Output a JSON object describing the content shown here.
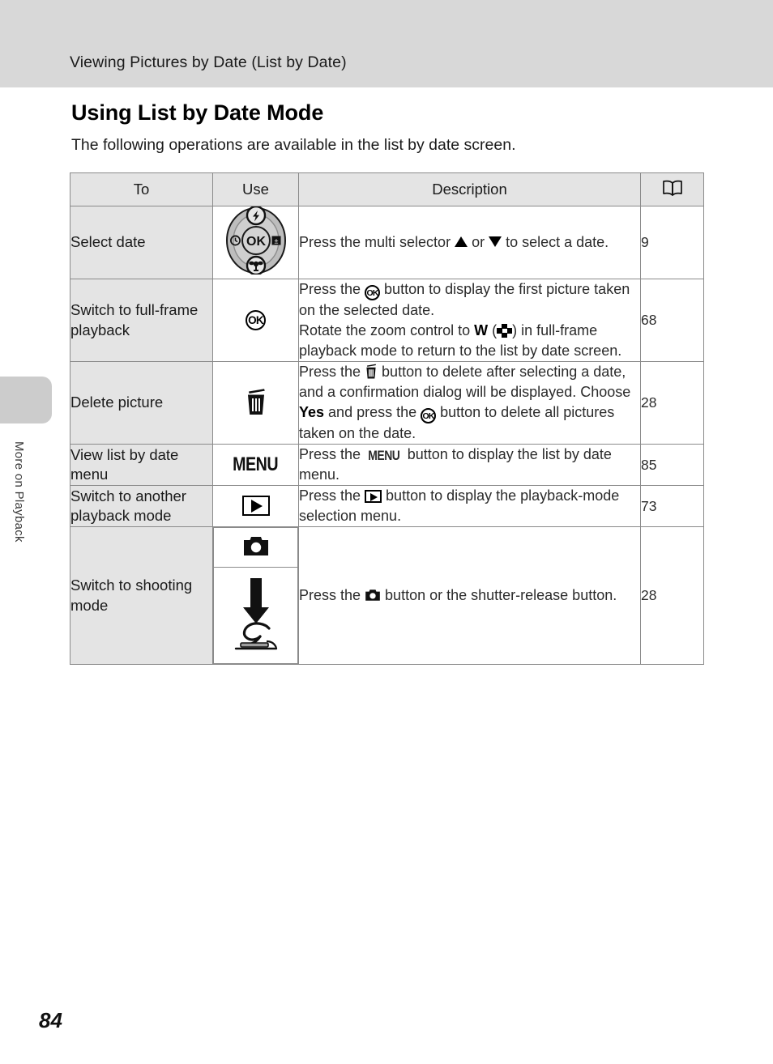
{
  "header": {
    "running_title": "Viewing Pictures by Date (List by Date)"
  },
  "side_tab": {
    "label": "More on Playback"
  },
  "section": {
    "heading": "Using List by Date Mode",
    "intro": "The following operations are available in the list by date screen."
  },
  "table": {
    "columns": {
      "to": "To",
      "use": "Use",
      "description": "Description",
      "reference": "book-icon"
    },
    "rows": [
      {
        "to": "Select date",
        "use_icon": "multi-selector-dial-icon",
        "desc_parts": [
          {
            "t": "text",
            "v": "Press the multi selector "
          },
          {
            "t": "icon",
            "v": "triangle-up-icon"
          },
          {
            "t": "text",
            "v": " or "
          },
          {
            "t": "icon",
            "v": "triangle-down-icon"
          },
          {
            "t": "text",
            "v": " to select a date."
          }
        ],
        "reference": "9"
      },
      {
        "to": "Switch to full-frame playback",
        "use_icon": "ok-button-icon",
        "desc_parts": [
          {
            "t": "text",
            "v": "Press the "
          },
          {
            "t": "icon",
            "v": "ok-button-icon"
          },
          {
            "t": "text",
            "v": " button to display the first picture taken on the selected date."
          },
          {
            "t": "break",
            "v": ""
          },
          {
            "t": "text",
            "v": "Rotate the zoom control to "
          },
          {
            "t": "bold",
            "v": "W"
          },
          {
            "t": "text",
            "v": " ("
          },
          {
            "t": "icon",
            "v": "thumbnail-checkerboard-icon"
          },
          {
            "t": "text",
            "v": ") in full-frame playback mode to return to the list by date screen."
          }
        ],
        "reference": "68"
      },
      {
        "to": "Delete picture",
        "use_icon": "trash-icon",
        "desc_parts": [
          {
            "t": "text",
            "v": "Press the "
          },
          {
            "t": "icon",
            "v": "trash-icon"
          },
          {
            "t": "text",
            "v": " button to delete after selecting a date, and a confirmation dialog will be displayed. Choose "
          },
          {
            "t": "bold",
            "v": "Yes"
          },
          {
            "t": "text",
            "v": " and press the "
          },
          {
            "t": "icon",
            "v": "ok-button-icon"
          },
          {
            "t": "text",
            "v": " button to delete all pictures taken on the date."
          }
        ],
        "reference": "28"
      },
      {
        "to": "View list by date menu",
        "use_icon": "menu-button-icon",
        "desc_parts": [
          {
            "t": "text",
            "v": "Press the "
          },
          {
            "t": "icon",
            "v": "menu-button-icon"
          },
          {
            "t": "text",
            "v": " button to display the list by date menu."
          }
        ],
        "reference": "85"
      },
      {
        "to": "Switch to another playback mode",
        "use_icon": "playback-button-icon",
        "desc_parts": [
          {
            "t": "text",
            "v": "Press the "
          },
          {
            "t": "icon",
            "v": "playback-button-icon"
          },
          {
            "t": "text",
            "v": " button to display the playback-mode selection menu."
          }
        ],
        "reference": "73"
      },
      {
        "to": "Switch to shooting mode",
        "use_icon_top": "camera-button-icon",
        "use_icon_bottom": "shutter-release-press-icon",
        "desc_parts": [
          {
            "t": "text",
            "v": "Press the "
          },
          {
            "t": "icon",
            "v": "camera-button-icon"
          },
          {
            "t": "text",
            "v": " button or the shutter-release button."
          }
        ],
        "reference": "28"
      }
    ]
  },
  "footer": {
    "page_number": "84"
  },
  "colors": {
    "header_band": "#d8d8d8",
    "row_label_bg": "#e4e4e4",
    "table_border": "#8a8a8a",
    "side_tab": "#cccccc"
  }
}
